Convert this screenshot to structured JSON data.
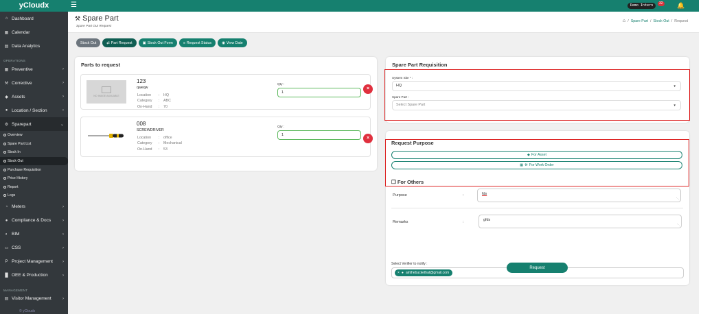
{
  "app": {
    "brand": "yCloudx"
  },
  "topbar": {
    "menu_icon": "hamburger-icon",
    "user_chip": "Demo Intern",
    "notification_count": "32",
    "bell_icon": "bell-icon"
  },
  "sidebar": {
    "main": [
      {
        "label": "Dashboard",
        "icon": "home-icon"
      },
      {
        "label": "Calendar",
        "icon": "calendar-icon"
      },
      {
        "label": "Data Analytics",
        "icon": "chart-icon"
      }
    ],
    "operations_header": "OPERATIONS",
    "operations": [
      {
        "label": "Preventive",
        "icon": "calendar-check-icon"
      },
      {
        "label": "Corrective",
        "icon": "wrench-icon"
      },
      {
        "label": "Assets",
        "icon": "tag-icon"
      },
      {
        "label": "Location / Section",
        "icon": "map-pin-icon"
      },
      {
        "label": "Sparepart",
        "icon": "gears-icon"
      }
    ],
    "sparepart_sub": [
      {
        "label": "Overview"
      },
      {
        "label": "Spare Part List"
      },
      {
        "label": "Stock In"
      },
      {
        "label": "Stock Out"
      },
      {
        "label": "Purchase Requisition"
      },
      {
        "label": "Price History"
      },
      {
        "label": "Report"
      },
      {
        "label": "Logs"
      }
    ],
    "more": [
      {
        "label": "Meters",
        "icon": "gauge-icon"
      },
      {
        "label": "Compliance & Docs",
        "icon": "document-icon"
      },
      {
        "label": "BIM",
        "icon": "cube-icon"
      },
      {
        "label": "CSS",
        "icon": "monitor-icon"
      },
      {
        "label": "Project Management",
        "icon": "project-icon"
      },
      {
        "label": "OEE & Production",
        "icon": "factory-icon"
      }
    ],
    "management_header": "MANAGEMENT",
    "management": [
      {
        "label": "Visitor Management",
        "icon": "id-card-icon"
      }
    ],
    "footer": "© yCloudx"
  },
  "page": {
    "title": "Spare Part",
    "subtitle": "Spare Part Out Request",
    "breadcrumb": [
      "Spare Part",
      "Stock Out",
      "Request"
    ]
  },
  "actions": [
    "Stock Out",
    "Part Request",
    "Stock Out Form",
    "Request Status",
    "View Date"
  ],
  "parts_card": {
    "title": "Parts to request",
    "qty_label": "Qty :",
    "location_label": "Location",
    "category_label": "Category",
    "onhand_label": "On-Hand",
    "no_image_text": "NO IMAGE AVAILABLE",
    "items": [
      {
        "code": "123",
        "name": "qweqw",
        "location": "HQ",
        "category": "ABC",
        "onhand": "70",
        "qty": "1"
      },
      {
        "code": "008",
        "name": "SCREWDRIVER",
        "location": "office",
        "category": "Mechanical",
        "onhand": "53",
        "qty": "1"
      }
    ]
  },
  "requisition": {
    "title": "Spare Part Requisition",
    "system_site_label": "System Site * :",
    "system_site_value": "HQ",
    "spare_part_label": "Spare Part :",
    "spare_part_placeholder": "Select Spare Part"
  },
  "purpose": {
    "title": "Request Purpose",
    "for_asset": "For Asset",
    "for_work_order": "For Work Order",
    "others_title": "For Others",
    "purpose_label": "Purpose",
    "purpose_value": "fds",
    "remarks_label": "Remarks",
    "remarks_value": "gfds",
    "verifier_label": "Select Verifier to notify :",
    "verifier_tag": "ainthebuckethat@gmail.com",
    "colon": ":"
  },
  "submit_label": "Request"
}
